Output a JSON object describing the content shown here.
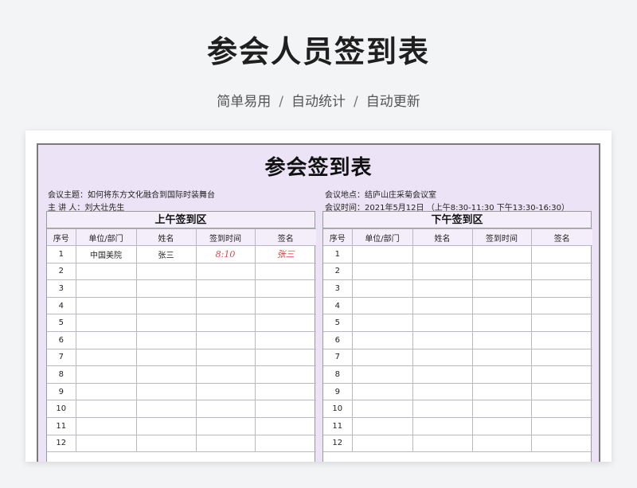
{
  "hero": {
    "title": "参会人员签到表",
    "features": [
      "简单易用",
      "自动统计",
      "自动更新"
    ],
    "separator": "/"
  },
  "sheet": {
    "title": "参会签到表",
    "topic_label": "会议主题：",
    "topic": "如何将东方文化融合到国际时装舞台",
    "speaker_label": "主 讲 人：",
    "speaker": "刘大壮先生",
    "location_label": "会议地点：",
    "location": "结庐山庄采菊会议室",
    "time_label": "会议时间：",
    "time": "2021年5月12日 （上午8:30-11:30   下午13:30-16:30）"
  },
  "columns": [
    "序号",
    "单位/部门",
    "姓名",
    "签到时间",
    "签名"
  ],
  "morning": {
    "title": "上午签到区",
    "rows": [
      {
        "no": "1",
        "dept": "中国美院",
        "name": "张三",
        "time": "8:10",
        "sign": "张三"
      },
      {
        "no": "2",
        "dept": "",
        "name": "",
        "time": "",
        "sign": ""
      },
      {
        "no": "3",
        "dept": "",
        "name": "",
        "time": "",
        "sign": ""
      },
      {
        "no": "4",
        "dept": "",
        "name": "",
        "time": "",
        "sign": ""
      },
      {
        "no": "5",
        "dept": "",
        "name": "",
        "time": "",
        "sign": ""
      },
      {
        "no": "6",
        "dept": "",
        "name": "",
        "time": "",
        "sign": ""
      },
      {
        "no": "7",
        "dept": "",
        "name": "",
        "time": "",
        "sign": ""
      },
      {
        "no": "8",
        "dept": "",
        "name": "",
        "time": "",
        "sign": ""
      },
      {
        "no": "9",
        "dept": "",
        "name": "",
        "time": "",
        "sign": ""
      },
      {
        "no": "10",
        "dept": "",
        "name": "",
        "time": "",
        "sign": ""
      },
      {
        "no": "11",
        "dept": "",
        "name": "",
        "time": "",
        "sign": ""
      },
      {
        "no": "12",
        "dept": "",
        "name": "",
        "time": "",
        "sign": ""
      }
    ]
  },
  "afternoon": {
    "title": "下午签到区",
    "rows": [
      {
        "no": "1",
        "dept": "",
        "name": "",
        "time": "",
        "sign": ""
      },
      {
        "no": "2",
        "dept": "",
        "name": "",
        "time": "",
        "sign": ""
      },
      {
        "no": "3",
        "dept": "",
        "name": "",
        "time": "",
        "sign": ""
      },
      {
        "no": "4",
        "dept": "",
        "name": "",
        "time": "",
        "sign": ""
      },
      {
        "no": "5",
        "dept": "",
        "name": "",
        "time": "",
        "sign": ""
      },
      {
        "no": "6",
        "dept": "",
        "name": "",
        "time": "",
        "sign": ""
      },
      {
        "no": "7",
        "dept": "",
        "name": "",
        "time": "",
        "sign": ""
      },
      {
        "no": "8",
        "dept": "",
        "name": "",
        "time": "",
        "sign": ""
      },
      {
        "no": "9",
        "dept": "",
        "name": "",
        "time": "",
        "sign": ""
      },
      {
        "no": "10",
        "dept": "",
        "name": "",
        "time": "",
        "sign": ""
      },
      {
        "no": "11",
        "dept": "",
        "name": "",
        "time": "",
        "sign": ""
      },
      {
        "no": "12",
        "dept": "",
        "name": "",
        "time": "",
        "sign": ""
      }
    ]
  },
  "colors": {
    "sheet_bg": "#ece3f6",
    "header_bg": "#f4eefa",
    "handwriting": "#e04848"
  }
}
